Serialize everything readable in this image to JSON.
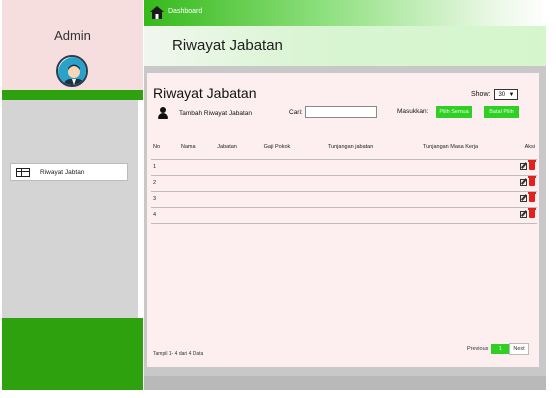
{
  "sidebar": {
    "admin_label": "Admin",
    "menu": [
      {
        "label": "Riwayat Jabtan",
        "icon": "table-icon"
      }
    ]
  },
  "topbar": {
    "breadcrumb": "Dashboard",
    "icon": "home-icon"
  },
  "header": {
    "title": "Riwayat Jabatan"
  },
  "panel": {
    "title": "Riwayat Jabatan",
    "show_label": "Show:",
    "show_value": "30",
    "add_label": "Tambah Riwayat Jabatan",
    "search_label": "Cari:",
    "search_value": "",
    "masukkan_label": "Masukkan:",
    "btn_pilih_semua": "Pilih Semua",
    "btn_batal_pilih": "Batal Pilih",
    "info": "Tampil 1- 4 dari 4 Data",
    "pagination": {
      "prev": "Previous",
      "current": "1",
      "next": "Next"
    }
  },
  "table": {
    "columns": [
      "No",
      "Nama",
      "Jabatan",
      "Gaji Pokok",
      "Tunjangan jabatan",
      "Tunjangan Masa Kerja",
      "Aksi"
    ],
    "rows": [
      {
        "no": "1"
      },
      {
        "no": "2"
      },
      {
        "no": "3"
      },
      {
        "no": "4"
      }
    ]
  },
  "colors": {
    "green": "#2ea10f",
    "button_green": "#2fcf23",
    "delete_red": "#e2231a",
    "panel_bg": "#fdefef"
  }
}
